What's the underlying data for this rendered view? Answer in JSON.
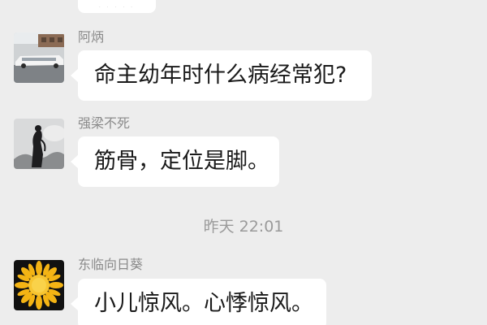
{
  "top_partial_message": {
    "text": "· · · · ·"
  },
  "messages": [
    {
      "sender": "阿炳",
      "text": "命主幼年时什么病经常犯?",
      "avatar": "limousine-photo-avatar"
    },
    {
      "sender": "强梁不死",
      "text": "筋骨，定位是脚。",
      "avatar": "silhouette-photo-avatar"
    },
    {
      "sender": "东临向日葵",
      "text": "小儿惊风。心悸惊风。",
      "avatar": "sunflower-avatar"
    }
  ],
  "timestamp": "昨天 22:01",
  "colors": {
    "background": "#ededed",
    "bubble": "#ffffff",
    "sender_name": "#8a8a8a",
    "timestamp": "#9a9a9a",
    "message_text": "#1a1a1a"
  }
}
